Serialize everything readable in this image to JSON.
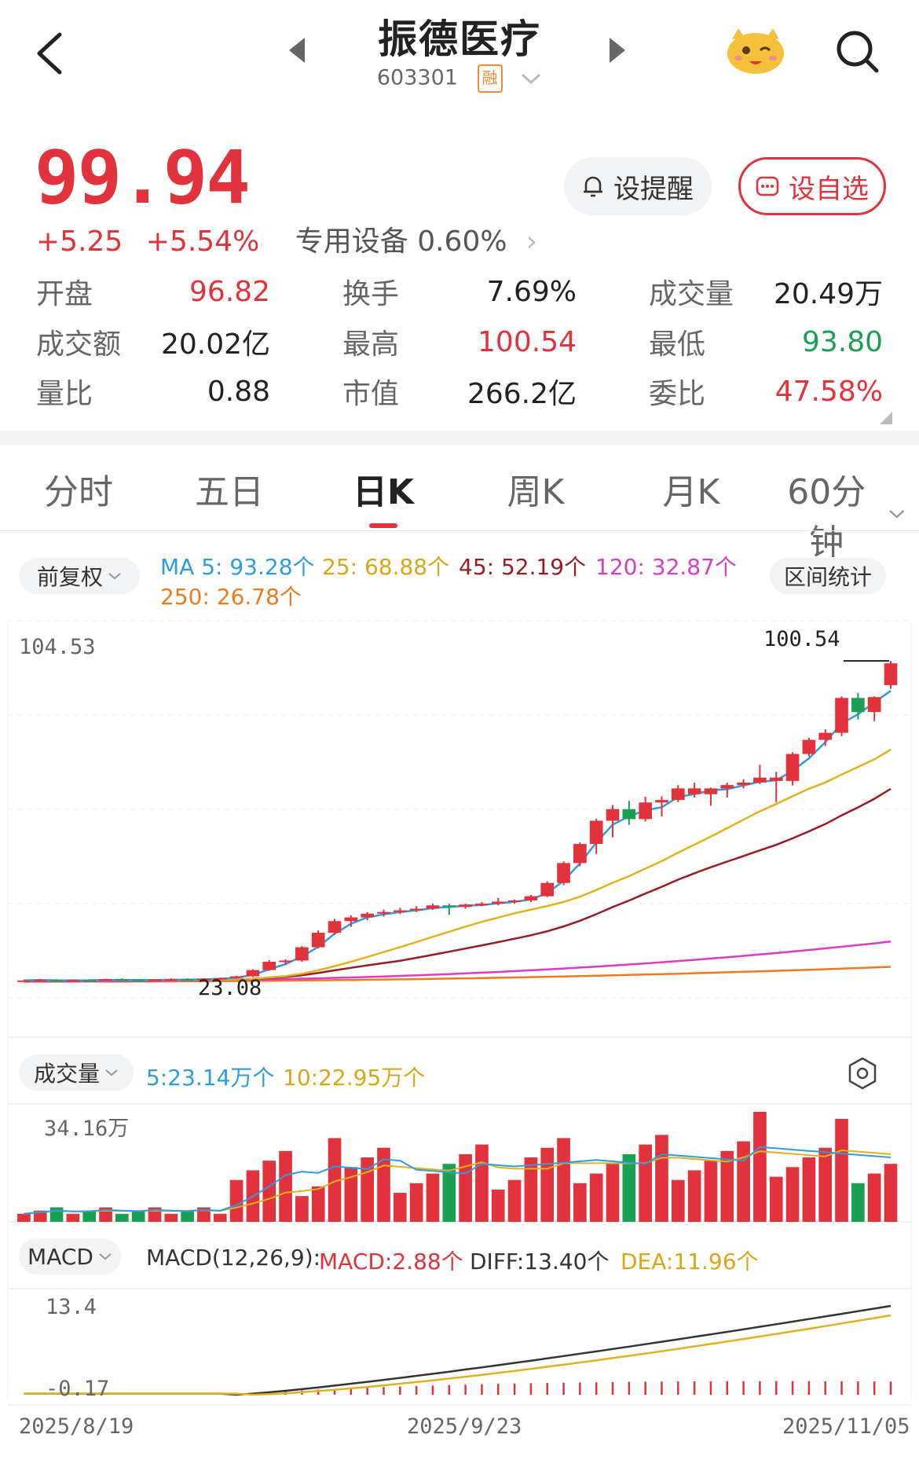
{
  "header": {
    "name": "振德医疗",
    "code": "603301",
    "margin_badge": "融"
  },
  "quote": {
    "price": "99.94",
    "change": "+5.25",
    "change_pct": "+5.54%",
    "sector": "专用设备 0.60%",
    "alert_label": "设提醒",
    "watch_label": "设自选"
  },
  "stats": [
    {
      "label": "开盘",
      "value": "96.82",
      "tone": "red"
    },
    {
      "label": "换手",
      "value": "7.69%",
      "tone": "neutral"
    },
    {
      "label": "成交量",
      "value": "20.49万",
      "tone": "neutral"
    },
    {
      "label": "成交额",
      "value": "20.02亿",
      "tone": "neutral"
    },
    {
      "label": "最高",
      "value": "100.54",
      "tone": "red"
    },
    {
      "label": "最低",
      "value": "93.80",
      "tone": "green"
    },
    {
      "label": "量比",
      "value": "0.88",
      "tone": "neutral"
    },
    {
      "label": "市值",
      "value": "266.2亿",
      "tone": "neutral"
    },
    {
      "label": "委比",
      "value": "47.58%",
      "tone": "red"
    }
  ],
  "tabs": [
    "分时",
    "五日",
    "日K",
    "周K",
    "月K",
    "60分钟"
  ],
  "active_tab": "日K",
  "kline": {
    "adjust_label": "前复权",
    "range_stats_label": "区间统计",
    "ma5": "MA 5: 93.28个",
    "ma25": "25: 68.88个",
    "ma45": "45: 52.19个",
    "ma120": "120: 32.87个",
    "ma250": "250: 26.78个",
    "y_top_label": "104.53",
    "high_label": "100.54",
    "low_label": "23.08"
  },
  "volume": {
    "label": "成交量",
    "ma5": "5:23.14万个",
    "ma10": "10:22.95万个",
    "top_label": "34.16万"
  },
  "macd": {
    "label": "MACD",
    "params": "MACD(12,26,9):",
    "macd": "MACD:2.88个",
    "diff": "DIFF:13.40个",
    "dea": "DEA:11.96个",
    "top_label": "13.4",
    "bottom_label": "-0.17"
  },
  "dates": [
    "2025/8/19",
    "2025/9/23",
    "2025/11/05"
  ],
  "colors": {
    "up": "#e2323b",
    "down": "#1aa053",
    "ma5": "#2d9ce0",
    "ma25": "#e0b21e",
    "ma45": "#9b1b1f",
    "ma120": "#e03bc0",
    "ma250": "#ee7a20"
  },
  "chart_data": {
    "type": "candlestick",
    "x_range": [
      "2025/8/19",
      "2025/11/05"
    ],
    "ylim": [
      23.08,
      104.53
    ],
    "high": 100.54,
    "low": 23.08,
    "last_close": 99.94,
    "candles_approx": [
      [
        23.4,
        23.6,
        23.2,
        23.5,
        1
      ],
      [
        23.5,
        23.9,
        23.3,
        23.6,
        1
      ],
      [
        23.6,
        23.8,
        23.3,
        23.4,
        0
      ],
      [
        23.4,
        23.7,
        23.2,
        23.6,
        1
      ],
      [
        23.6,
        23.8,
        23.4,
        23.5,
        0
      ],
      [
        23.5,
        23.9,
        23.4,
        23.8,
        1
      ],
      [
        23.8,
        24.0,
        23.5,
        23.6,
        0
      ],
      [
        23.6,
        23.8,
        23.3,
        23.5,
        0
      ],
      [
        23.5,
        23.8,
        23.3,
        23.7,
        1
      ],
      [
        23.7,
        24.0,
        23.5,
        23.8,
        1
      ],
      [
        23.8,
        24.0,
        23.5,
        23.6,
        0
      ],
      [
        23.6,
        24.0,
        23.4,
        23.9,
        1
      ],
      [
        23.9,
        24.2,
        23.7,
        24.1,
        1
      ],
      [
        24.1,
        24.6,
        23.9,
        24.5,
        1
      ],
      [
        24.5,
        26.2,
        24.3,
        26.0,
        1
      ],
      [
        26.0,
        28.4,
        25.8,
        28.0,
        1
      ],
      [
        28.0,
        28.6,
        27.2,
        28.3,
        1
      ],
      [
        28.3,
        31.8,
        28.0,
        31.5,
        1
      ],
      [
        31.5,
        35.6,
        31.2,
        35.0,
        1
      ],
      [
        35.0,
        38.3,
        34.5,
        37.8,
        1
      ],
      [
        37.8,
        39.2,
        36.4,
        38.7,
        1
      ],
      [
        38.7,
        40.0,
        38.0,
        39.6,
        1
      ],
      [
        39.6,
        40.6,
        38.9,
        40.0,
        1
      ],
      [
        40.0,
        41.0,
        39.5,
        40.4,
        1
      ],
      [
        40.4,
        41.4,
        40.0,
        40.8,
        1
      ],
      [
        40.8,
        42.0,
        40.5,
        41.6,
        1
      ],
      [
        41.6,
        42.0,
        39.3,
        41.2,
        0
      ],
      [
        41.2,
        42.0,
        40.8,
        41.8,
        1
      ],
      [
        41.8,
        42.4,
        41.4,
        42.0,
        1
      ],
      [
        42.0,
        43.4,
        41.6,
        42.5,
        1
      ],
      [
        42.5,
        43.0,
        42.0,
        42.8,
        1
      ],
      [
        42.8,
        44.1,
        42.4,
        43.8,
        1
      ],
      [
        43.8,
        47.4,
        43.6,
        47.0,
        1
      ],
      [
        47.0,
        52.2,
        46.5,
        51.8,
        1
      ],
      [
        51.8,
        56.8,
        51.0,
        56.4,
        1
      ],
      [
        56.4,
        62.5,
        54.0,
        62.0,
        1
      ],
      [
        62.0,
        65.8,
        58.0,
        64.8,
        1
      ],
      [
        64.8,
        66.8,
        61.0,
        62.4,
        0
      ],
      [
        62.4,
        67.8,
        61.8,
        66.4,
        1
      ],
      [
        66.4,
        67.9,
        63.0,
        67.0,
        1
      ],
      [
        67.0,
        70.6,
        66.5,
        69.8,
        1
      ],
      [
        69.8,
        71.2,
        67.6,
        68.4,
        1
      ],
      [
        68.4,
        70.0,
        65.6,
        69.8,
        1
      ],
      [
        69.8,
        71.2,
        67.6,
        70.6,
        1
      ],
      [
        70.6,
        72.0,
        69.8,
        71.2,
        1
      ],
      [
        71.2,
        75.5,
        70.8,
        72.4,
        1
      ],
      [
        72.4,
        73.8,
        66.5,
        71.6,
        1
      ],
      [
        71.6,
        78.5,
        70.5,
        78.1,
        1
      ],
      [
        78.1,
        82.0,
        77.5,
        81.5,
        1
      ],
      [
        81.5,
        84.0,
        80.0,
        83.2,
        1
      ],
      [
        83.2,
        92.0,
        82.4,
        91.6,
        1
      ],
      [
        91.6,
        92.8,
        86.4,
        88.2,
        0
      ],
      [
        88.2,
        92.0,
        86.0,
        91.8,
        1
      ],
      [
        94.69,
        100.54,
        93.8,
        99.94,
        1
      ]
    ],
    "series": [
      {
        "name": "MA 5",
        "last": 93.28
      },
      {
        "name": "25",
        "last": 68.88
      },
      {
        "name": "45",
        "last": 52.19
      },
      {
        "name": "120",
        "last": 32.87
      },
      {
        "name": "250",
        "last": 26.78
      }
    ],
    "volume_max": 34.16,
    "macd": {
      "diff": 13.4,
      "dea": 11.96,
      "macd": 2.88,
      "ylim": [
        -0.17,
        13.4
      ]
    }
  }
}
